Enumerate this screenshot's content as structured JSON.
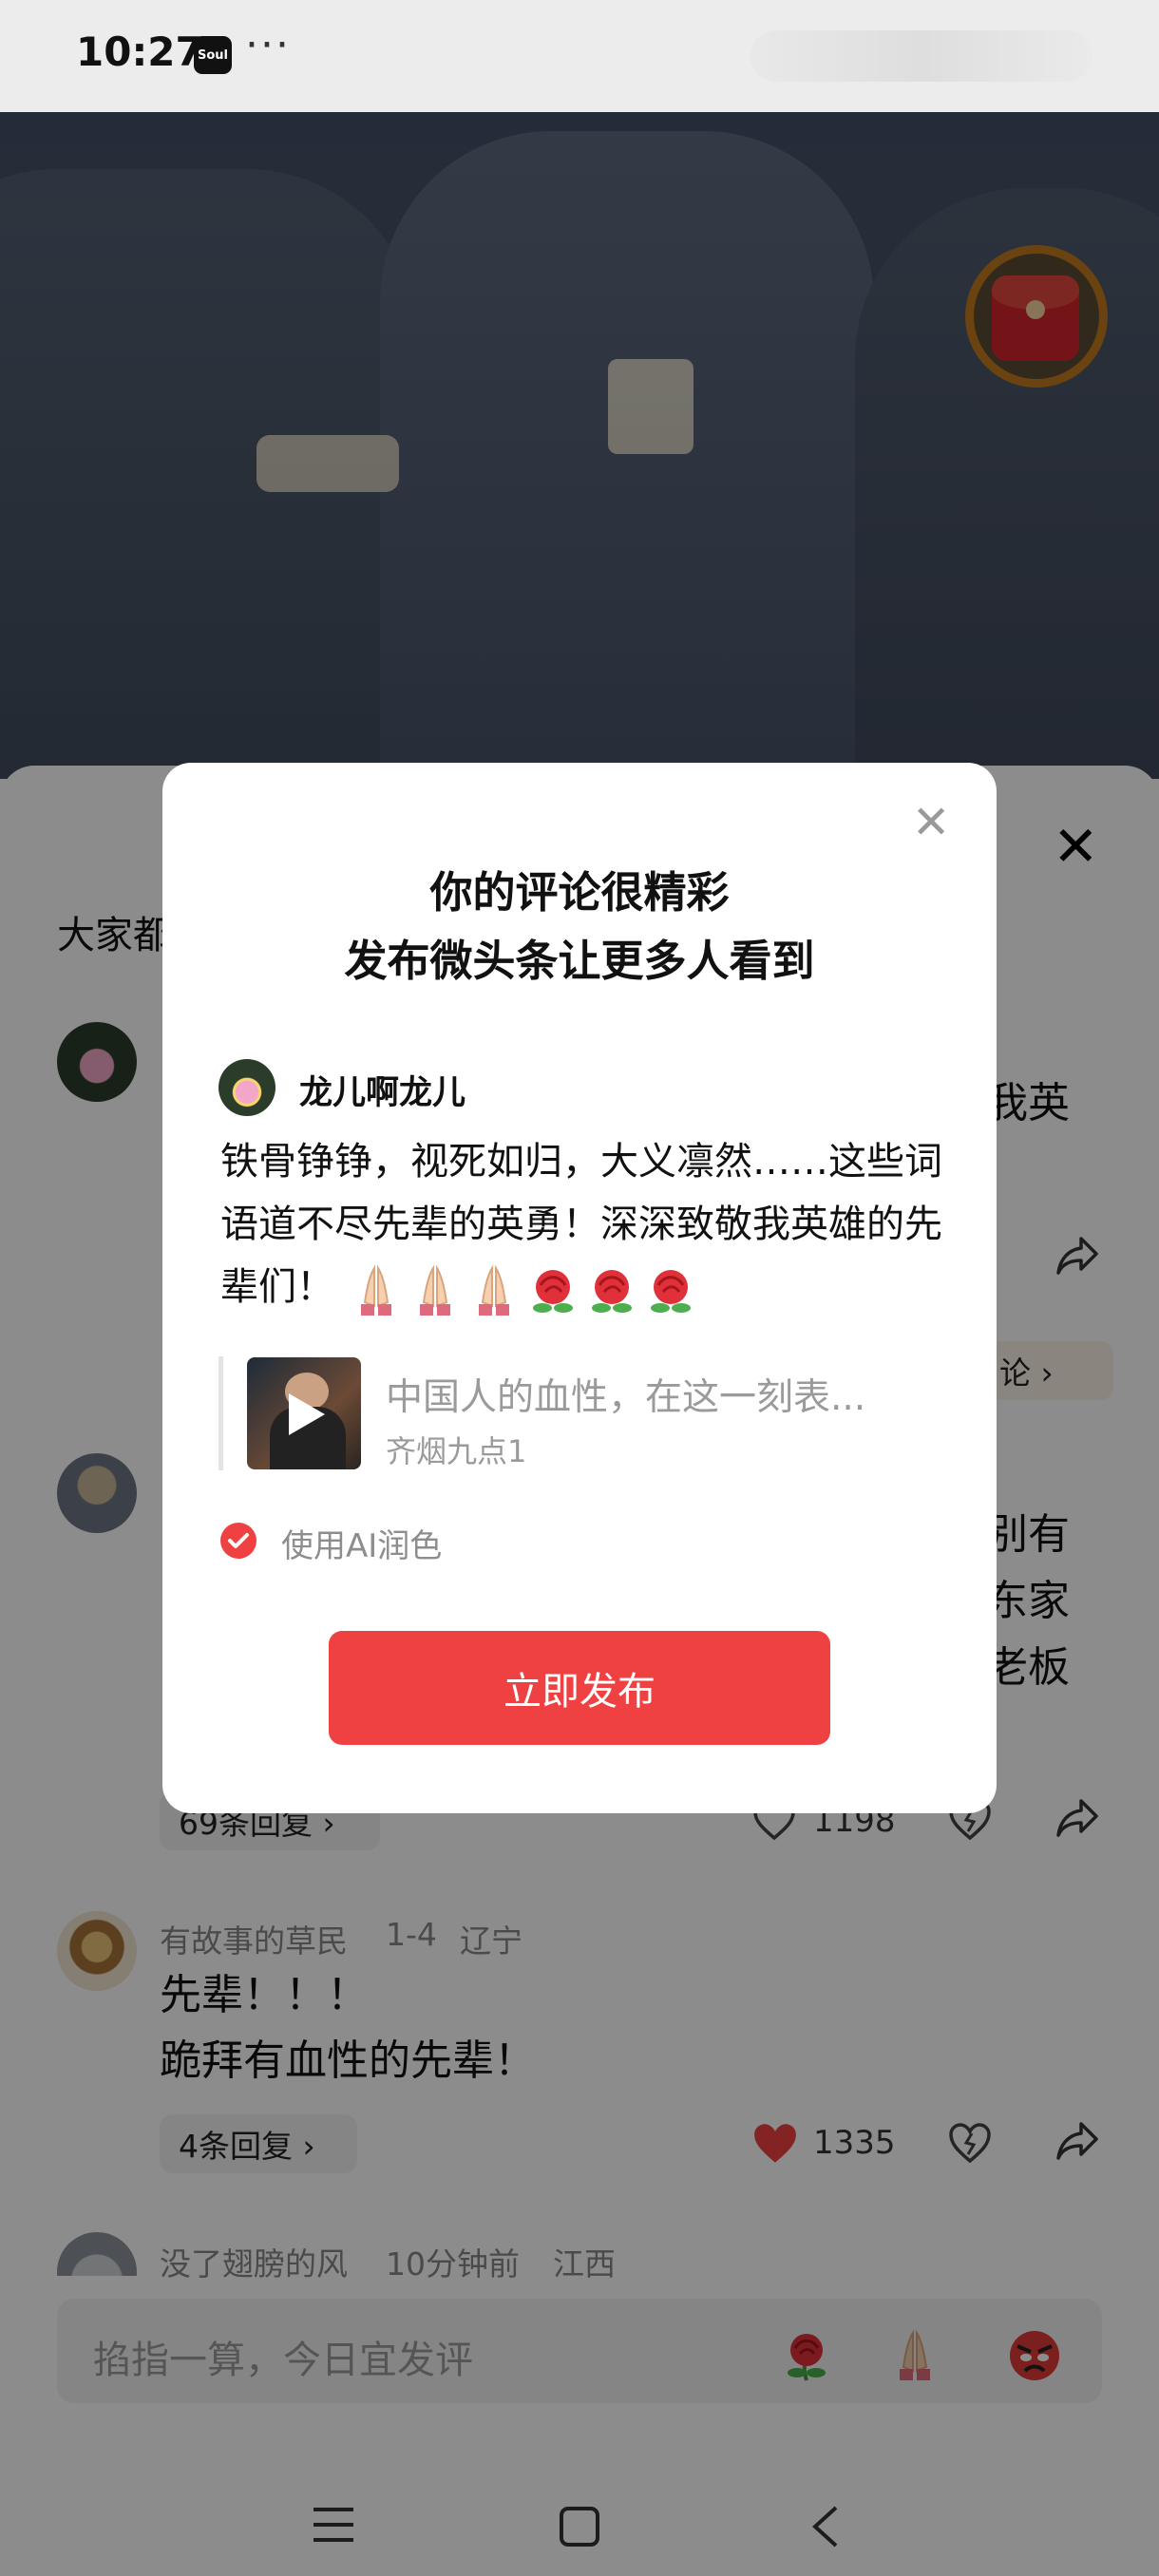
{
  "status_bar": {
    "time": "10:27",
    "app_badge": "Soul",
    "more_dots": "···"
  },
  "comments_panel": {
    "heading_partial": "大家都",
    "comments": [
      {
        "right_fragment": "我英",
        "reply_pill_partial": "论 ›"
      },
      {
        "right_fragments": [
          "别有",
          "东家",
          "老板"
        ],
        "replies_label": "69条回复 ›",
        "like_count": "1198"
      },
      {
        "author": "有故事的草民",
        "date": "1-4",
        "location": "辽宁",
        "lines": [
          "先辈！！！",
          "跪拜有血性的先辈！"
        ],
        "replies_label": "4条回复 ›",
        "like_count": "1335",
        "liked": true
      },
      {
        "author": "没了翅膀的风",
        "date": "10分钟前",
        "location": "江西"
      }
    ],
    "input_placeholder": "掐指一算，今日宜发评",
    "quick_emojis": [
      "rose-emoji",
      "praying-hands-emoji",
      "angry-face-emoji"
    ]
  },
  "dialog": {
    "title_line1": "你的评论很精彩",
    "title_line2": "发布微头条让更多人看到",
    "username": "龙儿啊龙儿",
    "body_text": "铁骨铮铮，视死如归，大义凛然……这些词语道不尽先辈的英勇！深深致敬我英雄的先辈们！",
    "body_emojis": [
      "praying-hands",
      "praying-hands",
      "praying-hands",
      "rose",
      "rose",
      "rose"
    ],
    "quote_title": "中国人的血性，在这一刻表...",
    "quote_source": "齐烟九点1",
    "ai_option_label": "使用AI润色",
    "ai_option_checked": true,
    "publish_label": "立即发布"
  },
  "colors": {
    "accent_red": "#f04142",
    "redpacket_ring": "#c47a1e",
    "text_primary": "#111111",
    "text_secondary": "#888888"
  }
}
